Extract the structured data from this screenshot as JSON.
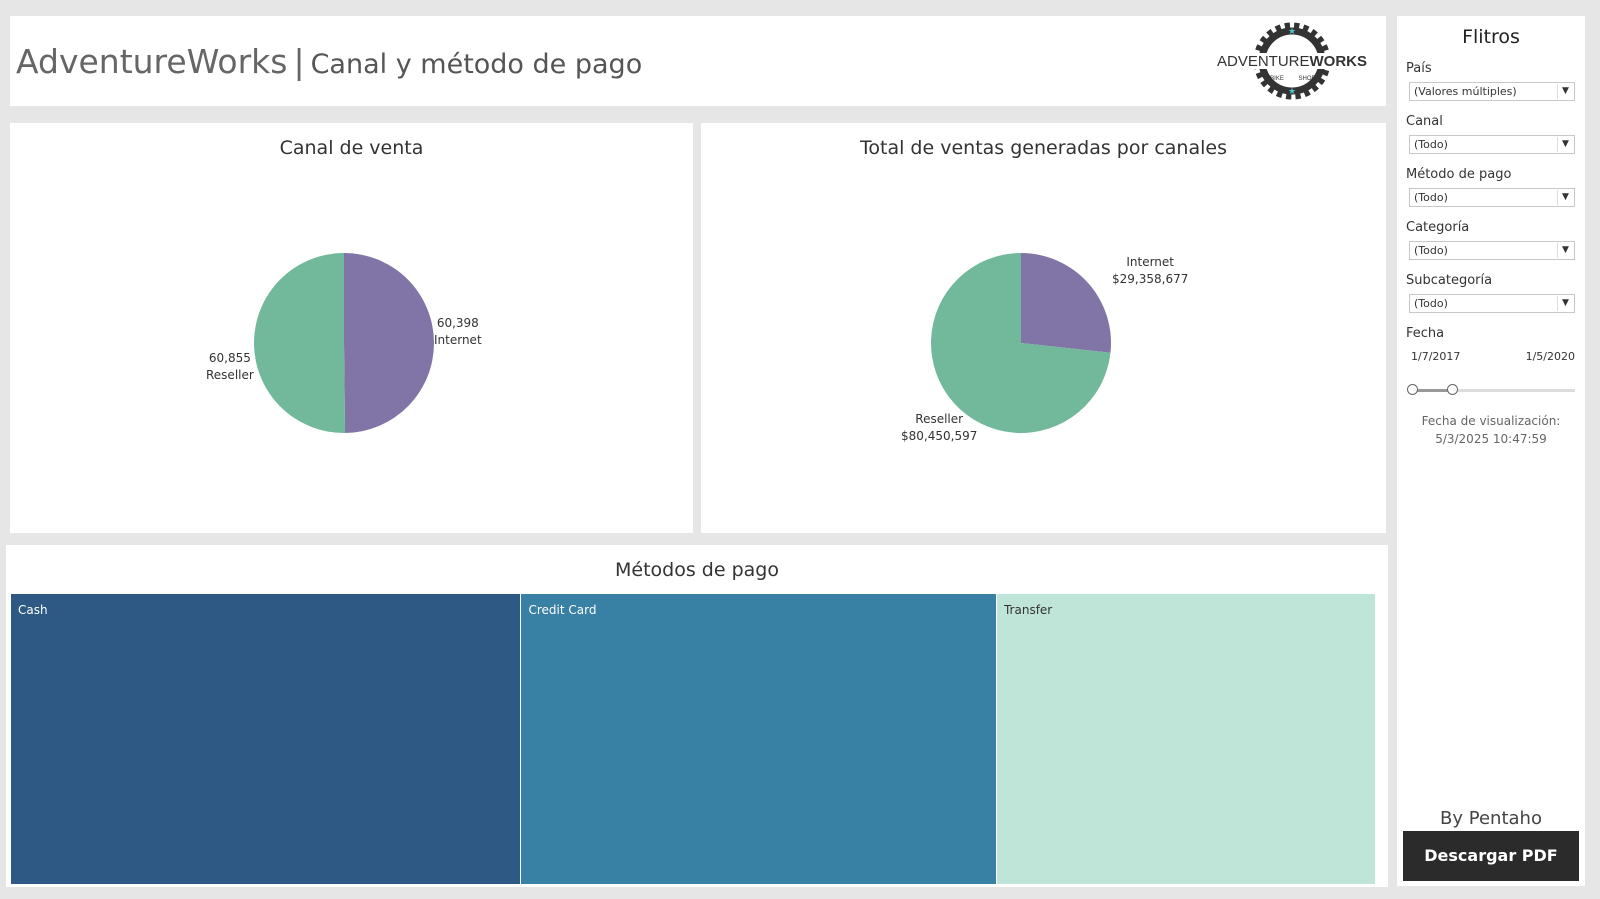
{
  "header": {
    "brand": "AdventureWorks",
    "separator": "|",
    "subtitle": "Canal y método de pago",
    "logo": {
      "top_text": "ADVENTURE",
      "top_text_bold": "WORKS",
      "bottom_left": "BIKE",
      "bottom_right": "SHOP"
    }
  },
  "charts": {
    "pie1": {
      "title": "Canal de venta",
      "labels": [
        {
          "value": "60,398",
          "name": "Internet"
        },
        {
          "value": "60,855",
          "name": "Reseller"
        }
      ]
    },
    "pie2": {
      "title": "Total de ventas generadas por canales",
      "labels": [
        {
          "name": "Internet",
          "value": "$29,358,677"
        },
        {
          "name": "Reseller",
          "value": "$80,450,597"
        }
      ]
    },
    "treemap": {
      "title": "Métodos de pago",
      "labels": [
        "Cash",
        "Credit Card",
        "Transfer"
      ]
    }
  },
  "chart_data": [
    {
      "type": "pie",
      "title": "Canal de venta",
      "categories": [
        "Internet",
        "Reseller"
      ],
      "values": [
        60398,
        60855
      ],
      "colors": [
        "#8175a8",
        "#72b89a"
      ]
    },
    {
      "type": "pie",
      "title": "Total de ventas generadas por canales",
      "categories": [
        "Internet",
        "Reseller"
      ],
      "values": [
        29358677,
        80450597
      ],
      "colors": [
        "#8175a8",
        "#72b89a"
      ]
    },
    {
      "type": "treemap",
      "title": "Métodos de pago",
      "categories": [
        "Cash",
        "Credit Card",
        "Transfer"
      ],
      "values": [
        0.365,
        0.34,
        0.271
      ],
      "colors": [
        "#2e5985",
        "#3880a4",
        "#bfe5d9"
      ],
      "label_colors": [
        "#ffffff",
        "#ffffff",
        "#333333"
      ]
    }
  ],
  "filters": {
    "title": "Flitros",
    "pais": {
      "label": "País",
      "value": "(Valores múltiples)"
    },
    "canal": {
      "label": "Canal",
      "value": "(Todo)"
    },
    "metodo": {
      "label": "Método de pago",
      "value": "(Todo)"
    },
    "categoria": {
      "label": "Categoría",
      "value": "(Todo)"
    },
    "subcategoria": {
      "label": "Subcategoría",
      "value": "(Todo)"
    },
    "fecha": {
      "label": "Fecha",
      "start": "1/7/2017",
      "end": "1/5/2020",
      "range_fraction": 0.25
    },
    "view_date_label": "Fecha de visualización:",
    "view_date_value": "5/3/2025 10:47:59",
    "by": "By Pentaho",
    "pdf_button": "Descargar PDF"
  },
  "colors": {
    "background": "#e6e6e6",
    "internet": "#8175a8",
    "reseller": "#72b89a",
    "button": "#2b2b2b"
  }
}
